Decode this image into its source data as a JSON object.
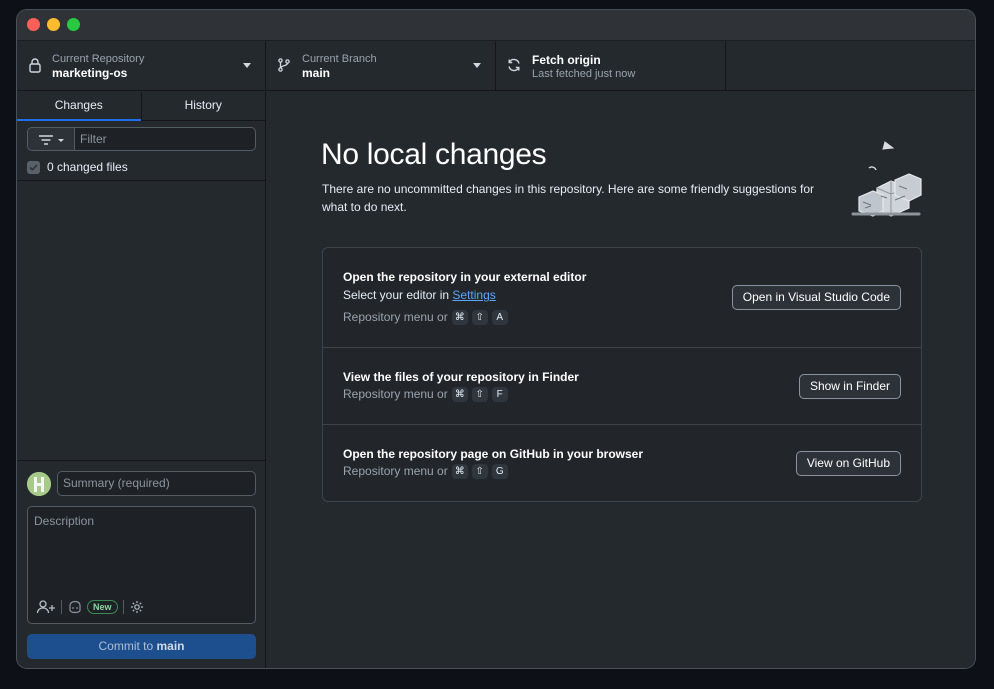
{
  "toolbar": {
    "repo": {
      "label": "Current Repository",
      "value": "marketing-os",
      "icon": "lock-icon"
    },
    "branch": {
      "label": "Current Branch",
      "value": "main",
      "icon": "git-branch-icon"
    },
    "fetch": {
      "title": "Fetch origin",
      "subtitle": "Last fetched just now",
      "icon": "sync-icon"
    }
  },
  "sidebar": {
    "tabs": [
      {
        "label": "Changes",
        "active": true
      },
      {
        "label": "History",
        "active": false
      }
    ],
    "filter_placeholder": "Filter",
    "changed_files": "0 changed files"
  },
  "commit": {
    "summary_placeholder": "Summary (required)",
    "description_placeholder": "Description",
    "new_badge": "New",
    "button_prefix": "Commit to ",
    "button_branch": "main"
  },
  "main": {
    "heading": "No local changes",
    "subtext": "There are no uncommitted changes in this repository. Here are some friendly suggestions for what to do next.",
    "cards": [
      {
        "title": "Open the repository in your external editor",
        "line_prefix": "Select your editor in ",
        "line_link": "Settings",
        "menu_label": "Repository menu or",
        "keys": [
          "⌘",
          "⇧",
          "A"
        ],
        "button": "Open in Visual Studio Code"
      },
      {
        "title": "View the files of your repository in Finder",
        "menu_label": "Repository menu or",
        "keys": [
          "⌘",
          "⇧",
          "F"
        ],
        "button": "Show in Finder"
      },
      {
        "title": "Open the repository page on GitHub in your browser",
        "menu_label": "Repository menu or",
        "keys": [
          "⌘",
          "⇧",
          "G"
        ],
        "button": "View on GitHub"
      }
    ]
  },
  "colors": {
    "accent": "#1f6feb",
    "commit_button": "#1d4f8f",
    "link": "#58a6ff"
  }
}
